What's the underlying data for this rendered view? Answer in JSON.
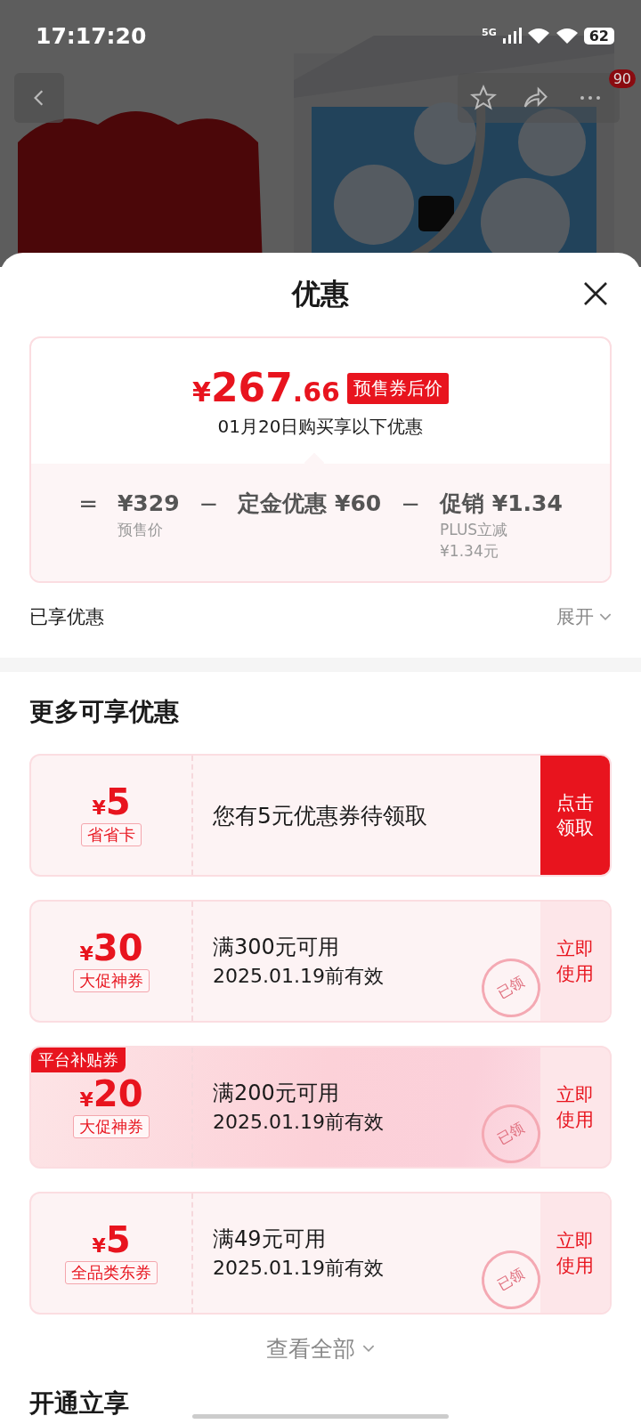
{
  "status_bar": {
    "time": "17:17:20",
    "network": "5G",
    "battery": "62"
  },
  "header": {
    "badge": "90"
  },
  "sheet": {
    "title": "优惠"
  },
  "summary": {
    "price": "¥267.66",
    "price_tag": "预售券后价",
    "subtitle": "01月20日购买享以下优惠",
    "terms": [
      {
        "operator": "=",
        "amount": "¥329",
        "notes": [
          "预售价"
        ]
      },
      {
        "operator": "−",
        "amount": "定金优惠 ¥60"
      },
      {
        "operator": "−",
        "amount": "促销 ¥1.34",
        "notes": [
          "PLUS立减",
          "¥1.34元"
        ]
      }
    ]
  },
  "enjoyed": {
    "label": "已享优惠",
    "toggle": "展开",
    "expanded": false
  },
  "more": {
    "title": "更多可享优惠",
    "coupons": [
      {
        "kind": "card",
        "amount": "¥5",
        "type": "省省卡",
        "condition": "您有5元优惠券待领取",
        "action": "点击领取"
      },
      {
        "kind": "coupon",
        "amount": "¥30",
        "type": "大促神券",
        "condition": "满300元可用",
        "validity": "2025.01.19前有效",
        "action": "立即使用",
        "stamp": "已领"
      },
      {
        "kind": "subsidy",
        "tag": "平台补贴券",
        "amount": "¥20",
        "type": "大促神券",
        "condition": "满200元可用",
        "validity": "2025.01.19前有效",
        "action": "立即使用",
        "stamp": "已领"
      },
      {
        "kind": "coupon",
        "amount": "¥5",
        "type": "全品类东券",
        "condition": "满49元可用",
        "validity": "2025.01.19前有效",
        "action": "立即使用",
        "stamp": "已领"
      }
    ],
    "view_all": "查看全部"
  },
  "next_section": {
    "title": "开通立享"
  }
}
